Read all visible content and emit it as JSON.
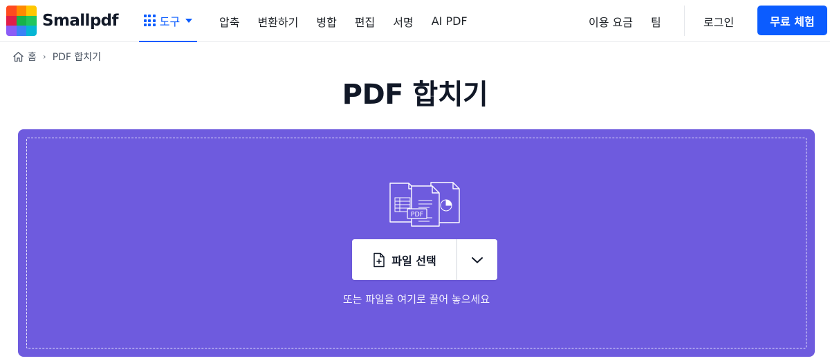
{
  "header": {
    "brand": "Smallpdf",
    "logo_colors": [
      "#ff4b1f",
      "#ff8a00",
      "#ffc700",
      "#e11d48",
      "#17b34a",
      "#22c55e",
      "#8b5cf6",
      "#3b82f6",
      "#06b6d4"
    ],
    "tools_label": "도구",
    "nav": [
      "압축",
      "변환하기",
      "병합",
      "편집",
      "서명",
      "AI PDF"
    ],
    "pricing_label": "이용 요금",
    "team_label": "팀",
    "login_label": "로그인",
    "trial_label": "무료 체험",
    "accent_color": "#0b5cff"
  },
  "breadcrumb": {
    "home_label": "홈",
    "separator": "›",
    "current": "PDF 합치기"
  },
  "main": {
    "title": "PDF 합치기",
    "dropzone": {
      "background_color": "#6e5bde",
      "illustration_badge": "PDF",
      "choose_file_label": "파일 선택",
      "hint": "또는 파일을 여기로 끌어 놓으세요"
    }
  }
}
